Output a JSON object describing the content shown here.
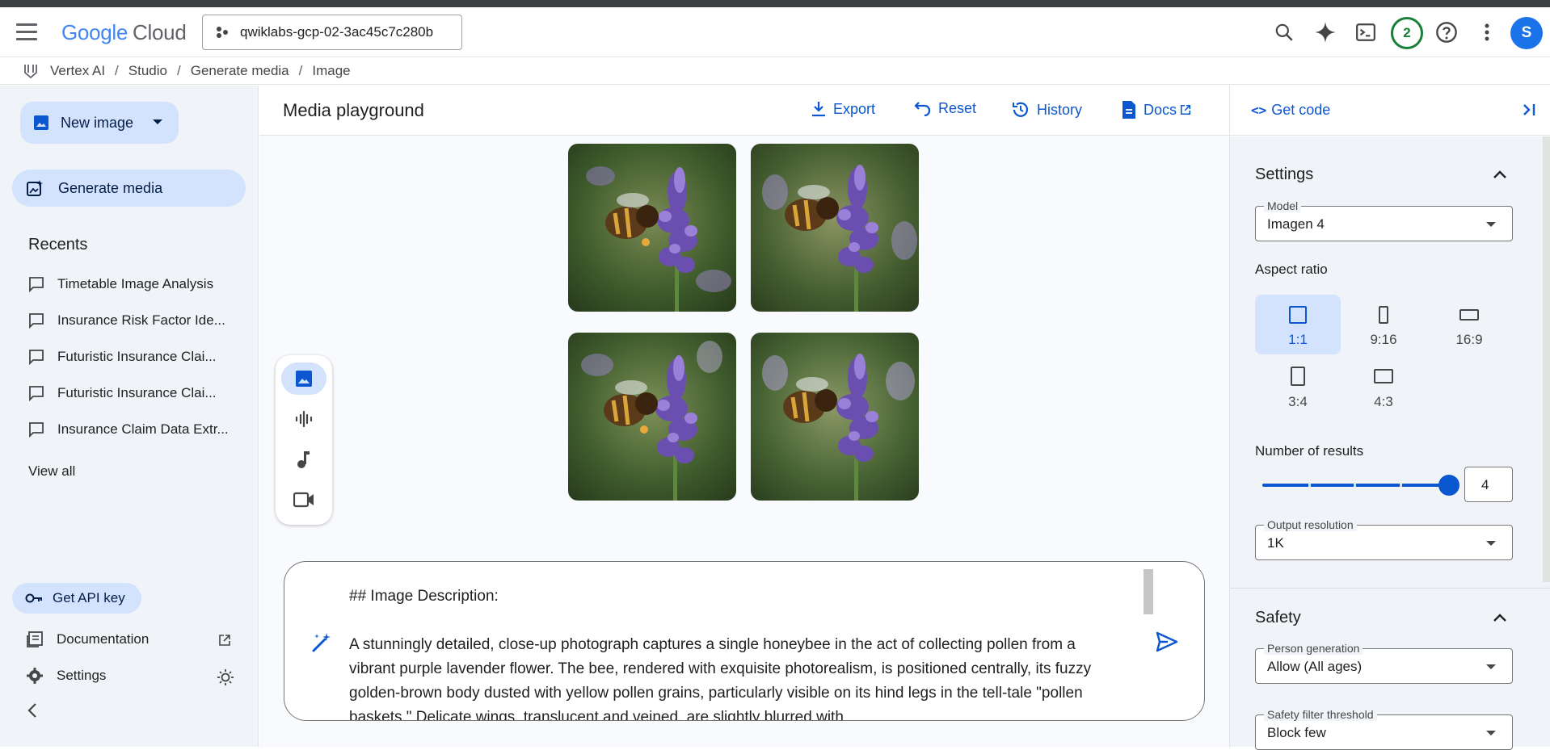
{
  "header": {
    "logo_brand": "Google",
    "logo_product": "Cloud",
    "project": "qwiklabs-gcp-02-3ac45c7c280b",
    "notif_count": "2",
    "avatar_initial": "S"
  },
  "breadcrumb": [
    "Vertex AI",
    "Studio",
    "Generate media",
    "Image"
  ],
  "sidebar": {
    "new_image": "New image",
    "generate_media": "Generate media",
    "recents_title": "Recents",
    "recents": [
      "Timetable Image Analysis",
      "Insurance Risk Factor Ide...",
      "Futuristic Insurance Clai...",
      "Futuristic Insurance Clai...",
      "Insurance Claim Data Extr..."
    ],
    "view_all": "View all",
    "get_api_key": "Get API key",
    "documentation": "Documentation",
    "settings": "Settings"
  },
  "main": {
    "title": "Media playground",
    "export": "Export",
    "reset": "Reset",
    "history": "History",
    "docs": "Docs",
    "images": [
      "honeybee-on-lavender-1",
      "honeybee-on-lavender-2",
      "honeybee-on-lavender-3",
      "honeybee-on-lavender-4"
    ],
    "prompt_heading": "## Image Description:",
    "prompt_body": "A stunningly detailed, close-up photograph captures a single honeybee in the act of collecting pollen from a vibrant purple lavender flower. The bee, rendered with exquisite photorealism, is positioned centrally, its fuzzy golden-brown body dusted with yellow pollen grains, particularly visible on its hind legs in the tell-tale \"pollen baskets.\" Delicate wings, translucent and veined, are slightly blurred with"
  },
  "panel": {
    "get_code": "Get code",
    "settings_title": "Settings",
    "model_label": "Model",
    "model_value": "Imagen 4",
    "aspect_label": "Aspect ratio",
    "aspect_options": [
      "1:1",
      "9:16",
      "16:9",
      "3:4",
      "4:3"
    ],
    "aspect_selected": "1:1",
    "results_label": "Number of results",
    "results_value": "4",
    "resolution_label": "Output resolution",
    "resolution_value": "1K",
    "safety_title": "Safety",
    "person_label": "Person generation",
    "person_value": "Allow (All ages)",
    "filter_label": "Safety filter threshold",
    "filter_value": "Block few"
  },
  "colors": {
    "accent": "#0b57d0",
    "selected_bg": "#d3e3fd",
    "sidebar_bg": "#f0f4f9"
  }
}
